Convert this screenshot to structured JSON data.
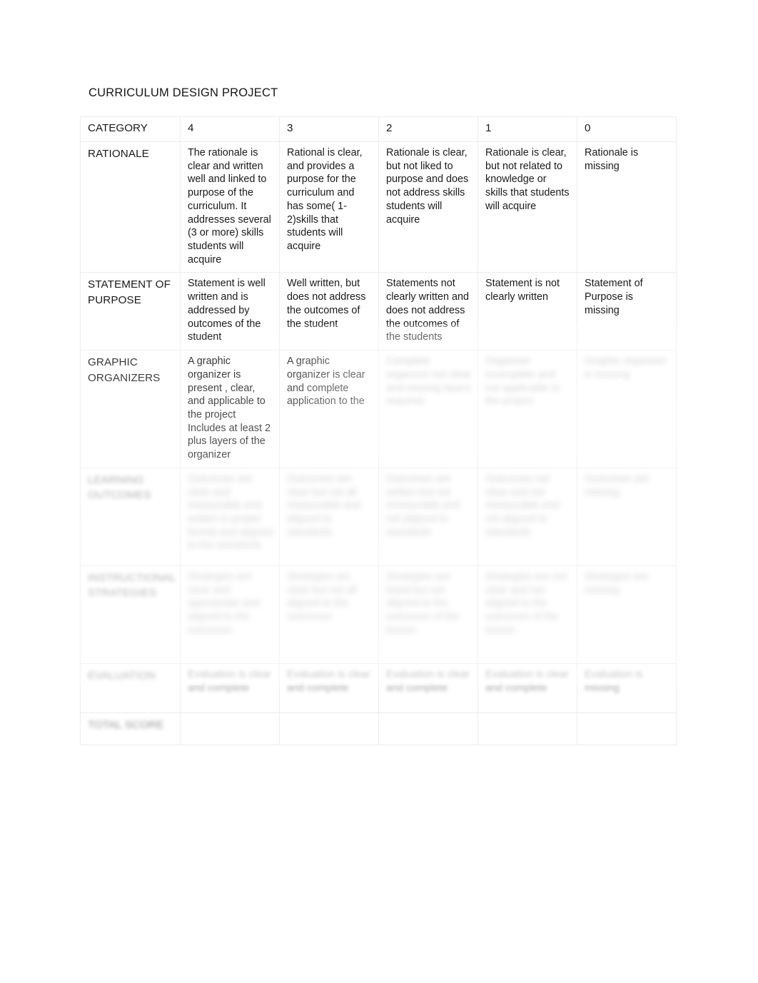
{
  "document": {
    "title": "CURRICULUM DESIGN PROJECT"
  },
  "table": {
    "headers": {
      "category": "CATEGORY",
      "s4": "4",
      "s3": "3",
      "s2": "2",
      "s1": "1",
      "s0": "0"
    },
    "rows": [
      {
        "category": "RATIONALE",
        "obscured": false,
        "cells": {
          "s4": "The rationale is clear and written well and linked to purpose of the curriculum.  It addresses  several (3 or more) skills students will acquire",
          "s3": "Rational  is clear, and provides a purpose for the curriculum and has some( 1-2)skills that students will acquire",
          "s2": "Rationale is clear, but not liked to purpose and does not address skills students will acquire",
          "s1": "Rationale is clear, but not related to knowledge or skills that students will acquire",
          "s0": "Rationale is missing"
        }
      },
      {
        "category": "STATEMENT OF PURPOSE",
        "obscured": false,
        "cells": {
          "s4": "Statement is well written and is addressed by outcomes of the student",
          "s3": "Well written, but does not address the outcomes of the student",
          "s2": "Statements not clearly written and does not address the outcomes of the students",
          "s1": "Statement is not clearly written",
          "s0": "Statement of Purpose is missing"
        }
      },
      {
        "category": "GRAPHIC ORGANIZERS",
        "obscured": false,
        "cells": {
          "s4": "A graphic organizer is present , clear, and applicable  to the project Includes at least 2 plus layers of the organizer",
          "s3": "A graphic organizer is clear and complete application to the",
          "s2": "",
          "s1": "",
          "s0": ""
        }
      }
    ],
    "obscured_note": "Lower table rows are blurred and illegible in the source image."
  },
  "colors": {
    "page_background": "#ffffff",
    "text": "#1a1a1a",
    "border": "#ececec"
  }
}
